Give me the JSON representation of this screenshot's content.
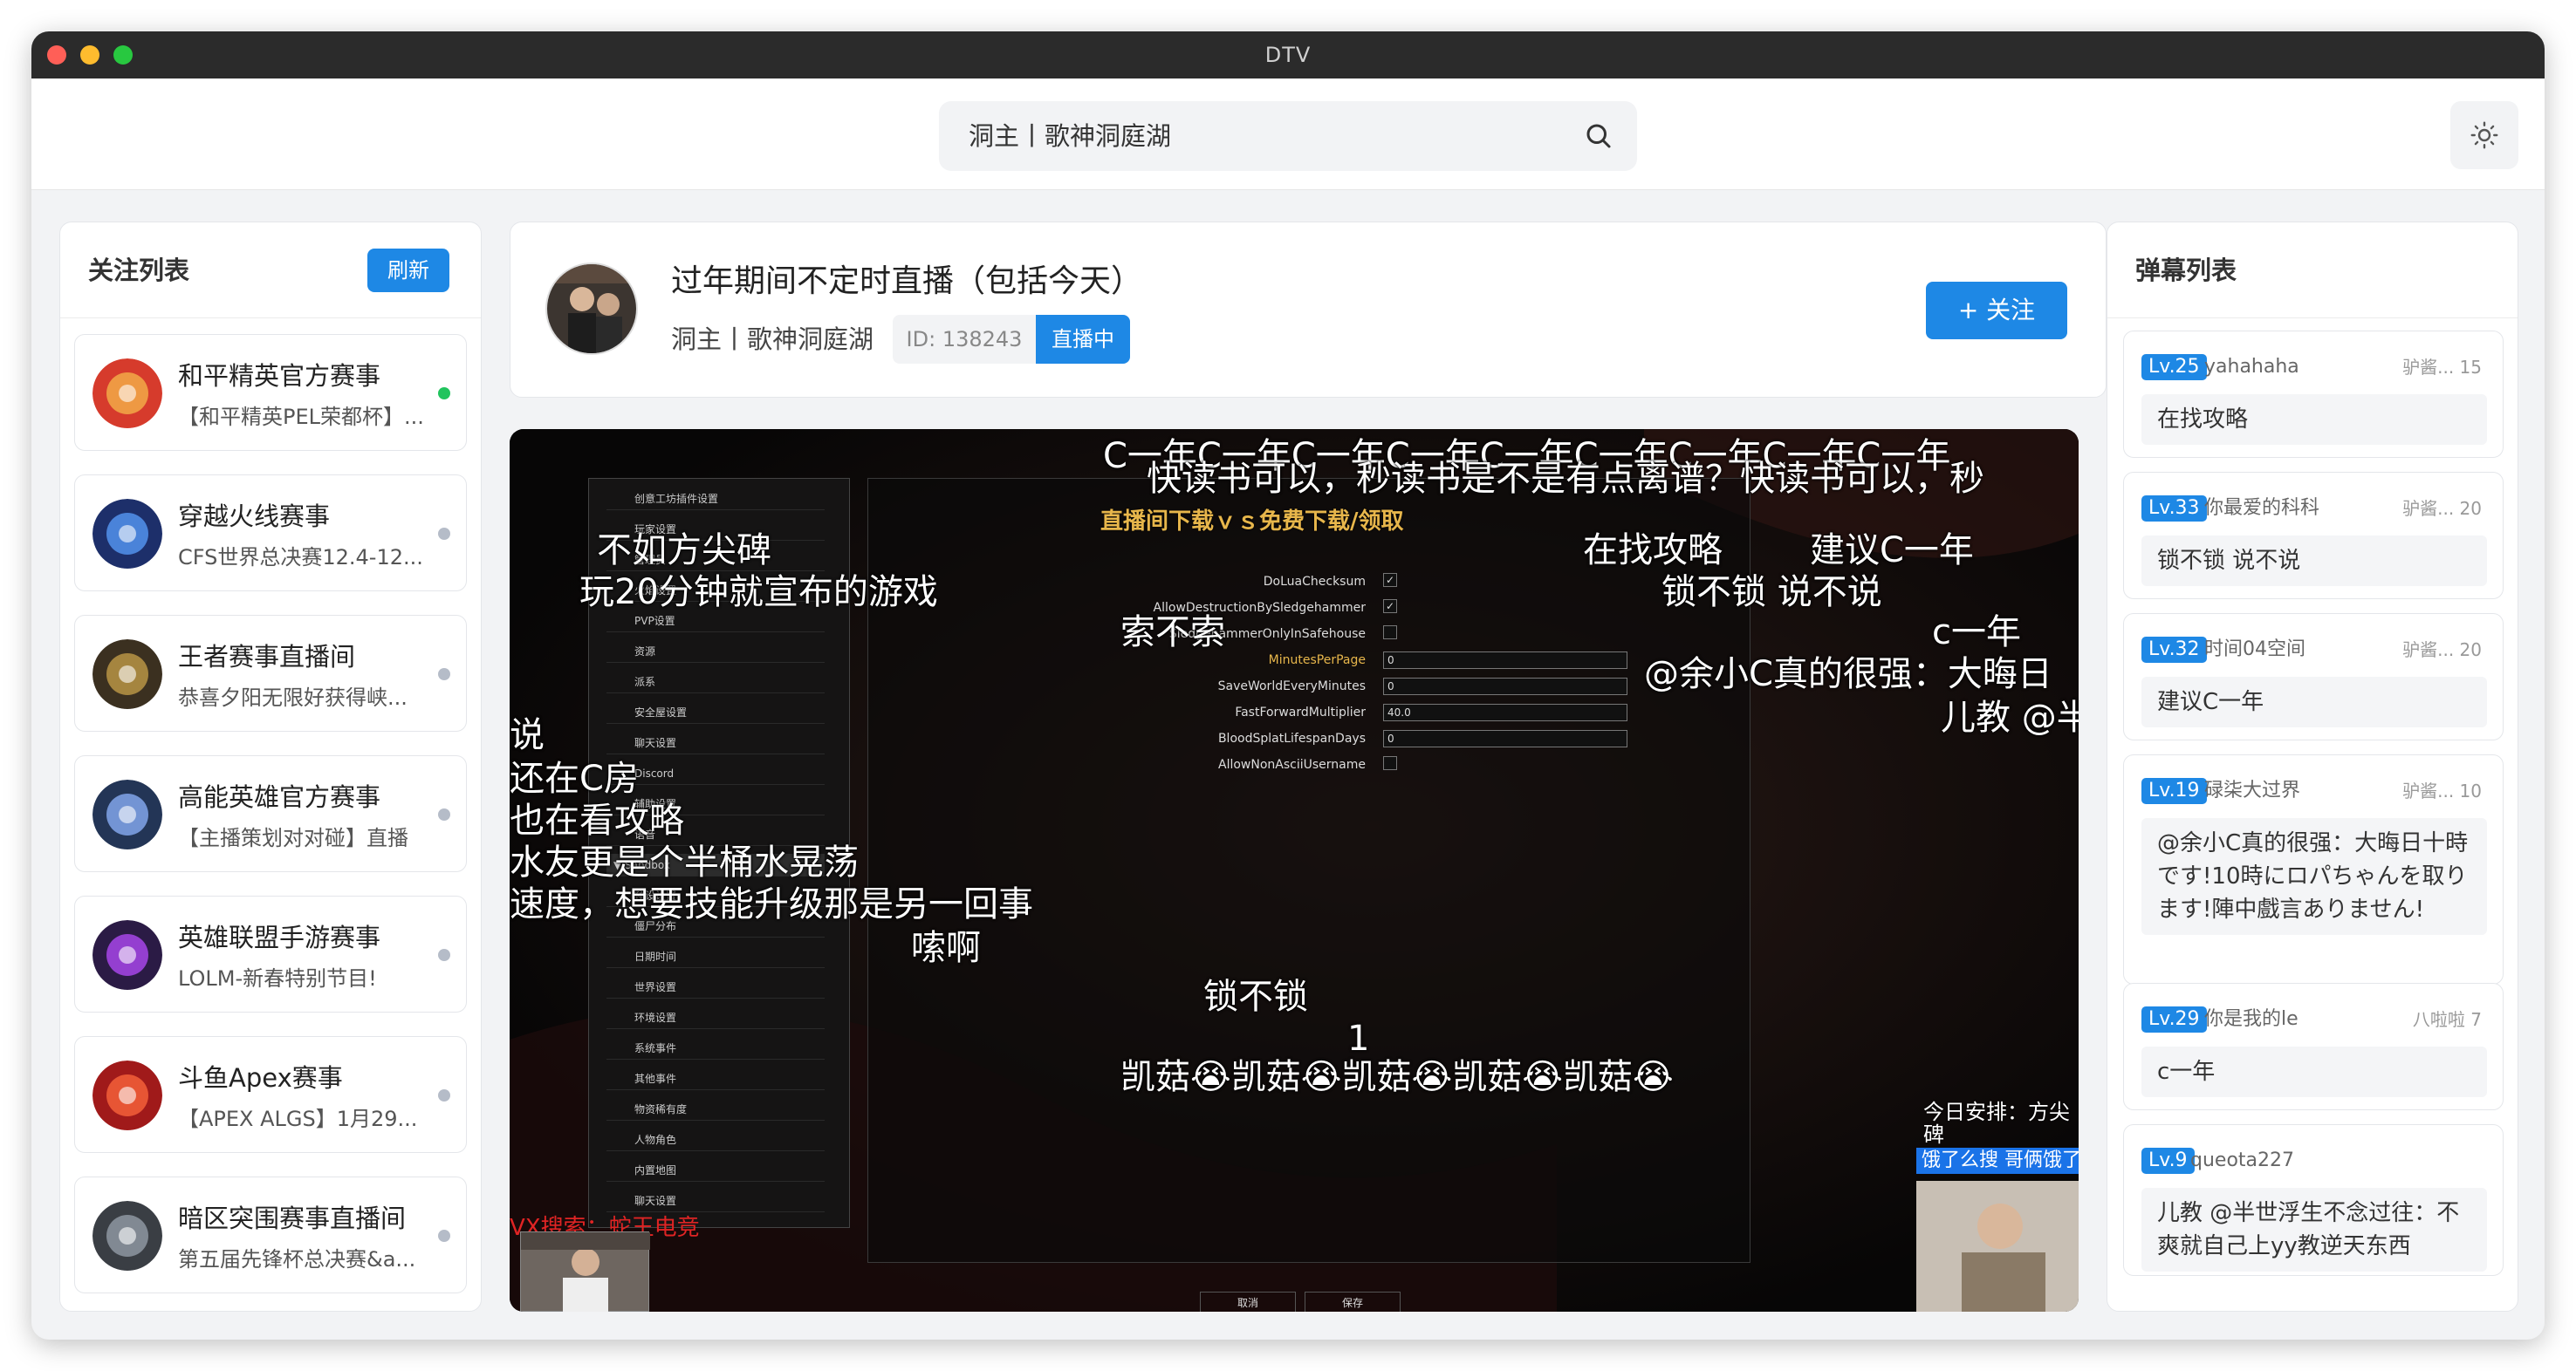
{
  "window": {
    "title": "DTV"
  },
  "search": {
    "value": "洞主丨歌神洞庭湖"
  },
  "follow_list": {
    "title": "关注列表",
    "refresh_label": "刷新",
    "items": [
      {
        "name": "和平精英官方赛事",
        "desc": "【和平精英PEL荣都杯】...",
        "status": "live",
        "status_color": "#21c45d"
      },
      {
        "name": "穿越火线赛事",
        "desc": "CFS世界总决赛12.4-12...",
        "status": "offline",
        "status_color": "#b5bcc8"
      },
      {
        "name": "王者赛事直播间",
        "desc": "恭喜夕阳无限好获得峡...",
        "status": "offline",
        "status_color": "#b5bcc8"
      },
      {
        "name": "高能英雄官方赛事",
        "desc": "【主播策划对对碰】直播",
        "status": "offline",
        "status_color": "#b5bcc8"
      },
      {
        "name": "英雄联盟手游赛事",
        "desc": "LOLM-新春特别节目!",
        "status": "offline",
        "status_color": "#b5bcc8"
      },
      {
        "name": "斗鱼Apex赛事",
        "desc": "【APEX ALGS】1月29...",
        "status": "offline",
        "status_color": "#b5bcc8"
      },
      {
        "name": "暗区突围赛事直播间",
        "desc": "第五届先锋杯总决赛&a...",
        "status": "offline",
        "status_color": "#b5bcc8"
      }
    ]
  },
  "room": {
    "title": "过年期间不定时直播（包括今天）",
    "host": "洞主丨歌神洞庭湖",
    "id_label": "ID: 138243",
    "live_label": "直播中",
    "follow_label": "+ 关注",
    "accent": "#1e88e5"
  },
  "video": {
    "overlay_title": "直播间下载ｖｓ免费下载/领取",
    "menu_items": [
      "创意工坊插件设置",
      "玩家设置",
      "管理员",
      "火焰设置",
      "PVP设置",
      "资源",
      "派系",
      "安全屋设置",
      "聊天设置",
      "Discord",
      "辅助设置",
      "语音",
      "▼ Sandbox",
      "预设设置",
      "僵尸分布",
      "日期时间",
      "世界设置",
      "环境设置",
      "系统事件",
      "其他事件",
      "物资稀有度",
      "人物角色",
      "内置地图",
      "聊天设置"
    ],
    "settings": [
      {
        "label": "DoLuaChecksum",
        "value": "✓"
      },
      {
        "label": "AllowDestructionBySledgehammer",
        "value": "✓"
      },
      {
        "label": "SledgehammerOnlyInSafehouse",
        "value": ""
      },
      {
        "label": "MinutesPerPage",
        "value": "0"
      },
      {
        "label": "SaveWorldEveryMinutes",
        "value": "0"
      },
      {
        "label": "FastForwardMultiplier",
        "value": "40.0"
      },
      {
        "label": "BloodSplatLifespanDays",
        "value": "0"
      },
      {
        "label": "AllowNonAsciiUsername",
        "value": ""
      }
    ],
    "cancel_label": "取消",
    "save_label": "保存",
    "vx_text": "VX搜索：蛇王电竞",
    "schedule_text": "今日安排：方尖碑",
    "ad_text": "饿了么搜 哥俩饿了",
    "danmu": [
      "C一年C一年C一年C一年C一年C一年C一年C一年C一年",
      "快读书可以，秒读书是不是有点离谱？快读书可以，秒",
      "不如方尖碑",
      "在找攻略",
      "建议C一年",
      "玩20分钟就宣布的游戏",
      "锁不锁 说不说",
      "索不索",
      "c一年",
      "@余小C真的很强：大晦日",
      "儿教 @半",
      "说",
      "还在C房",
      "也在看攻略",
      "水友更是个半桶水晃荡",
      "速度，想要技能升级那是另一回事",
      "嗦啊",
      "锁不锁",
      "1",
      "凯菇😭凯菇😭凯菇😭凯菇😭凯菇😭"
    ]
  },
  "danmaku_list": {
    "title": "弹幕列表",
    "items": [
      {
        "level": "Lv.25",
        "user": "yahahaha",
        "room": "驴酱... 15",
        "text": "在找攻略"
      },
      {
        "level": "Lv.33",
        "user": "你最爱的科科",
        "room": "驴酱... 20",
        "text": "锁不锁 说不说"
      },
      {
        "level": "Lv.32",
        "user": "时间04空间",
        "room": "驴酱... 20",
        "text": "建议C一年"
      },
      {
        "level": "Lv.19",
        "user": "碌柒大过界",
        "room": "驴酱... 10",
        "text": "@余小C真的很强：大晦日十時です!10時にロパちゃんを取ります!陣中戲言ありません!"
      },
      {
        "level": "Lv.29",
        "user": "你是我的le",
        "room": "八啦啦 7",
        "text": "c一年"
      },
      {
        "level": "Lv.9",
        "user": "queota227",
        "room": "",
        "text": "儿教 @半世浮生不念过往：不爽就自己上yy教逆天东西"
      }
    ]
  }
}
